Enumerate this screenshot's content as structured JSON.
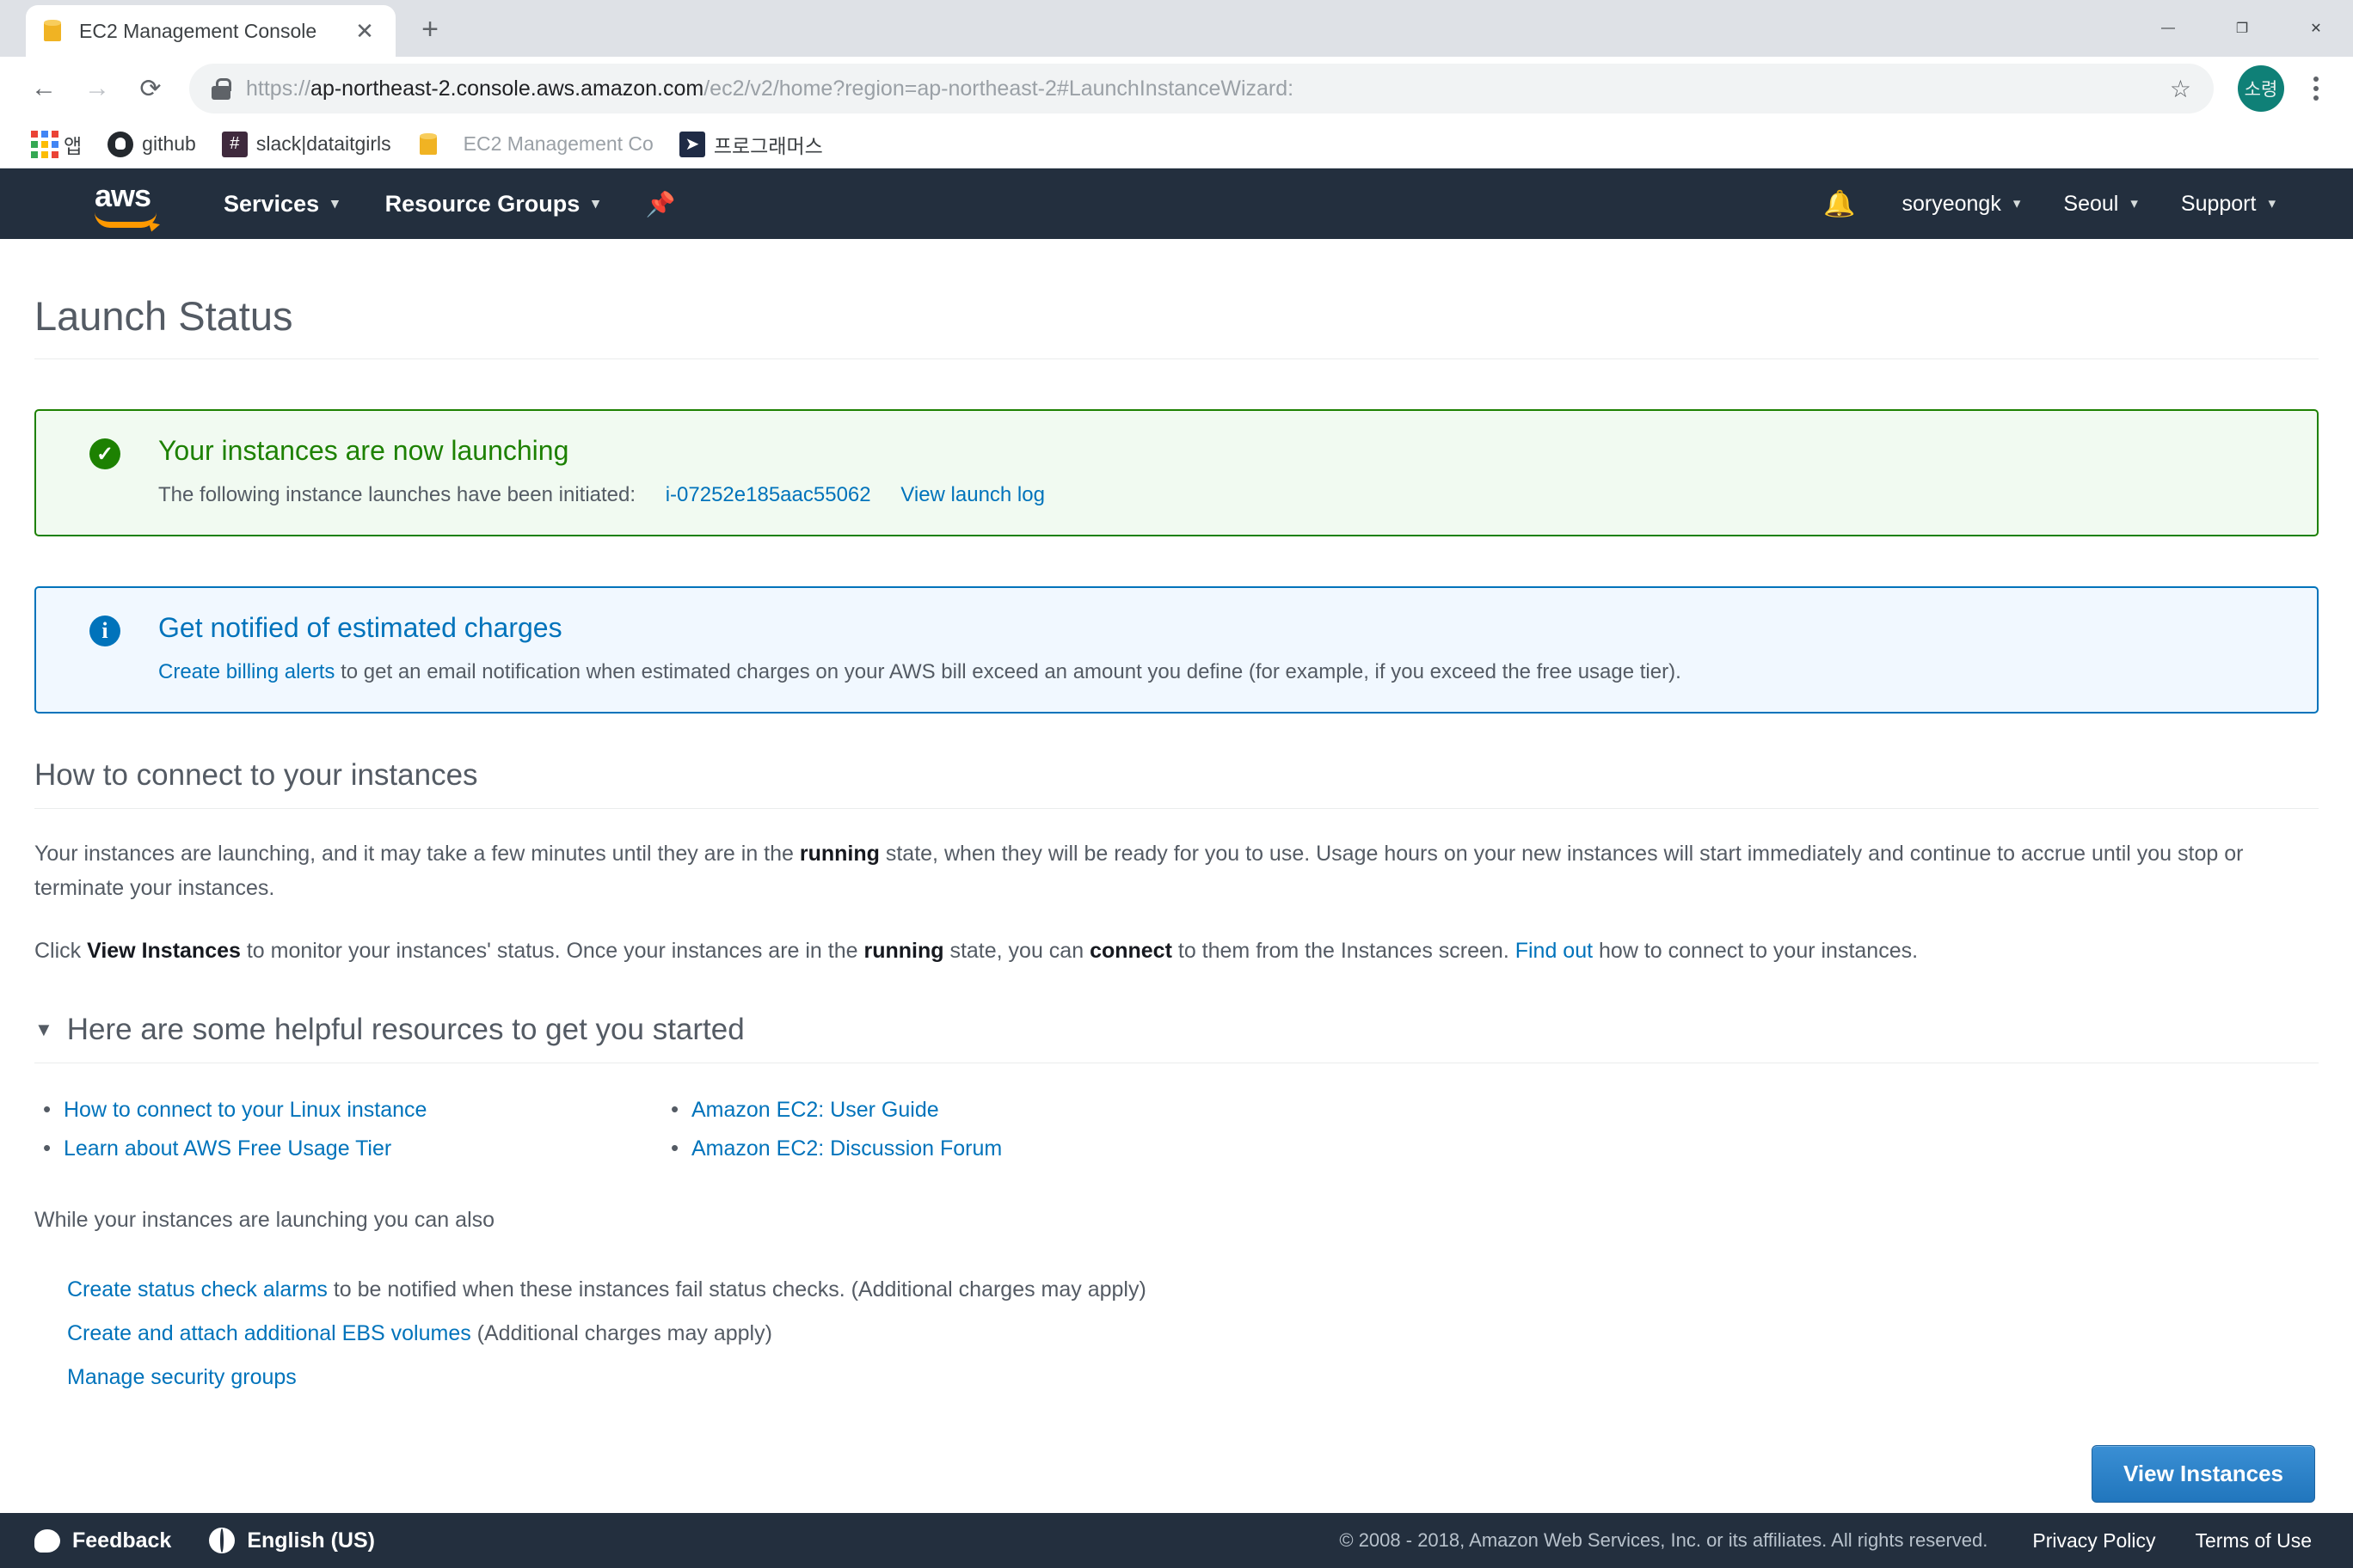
{
  "browser": {
    "tab": {
      "title": "EC2 Management Console",
      "favicon": "cube-icon",
      "close": "✕"
    },
    "new_tab_label": "+",
    "window_controls": {
      "minimize": "—",
      "maximize": "❐",
      "close": "✕"
    },
    "nav": {
      "back": "←",
      "forward": "→",
      "reload": "⟳"
    },
    "address": {
      "scheme": "https://",
      "host": "ap-northeast-2.console.aws.amazon.com",
      "path": "/ec2/v2/home?region=ap-northeast-2#LaunchInstanceWizard:",
      "star": "☆"
    },
    "profile_initials": "소령",
    "bookmarks": [
      {
        "label": "앱",
        "icon": "apps-grid-icon"
      },
      {
        "label": "github",
        "icon": "github-icon"
      },
      {
        "label": "slack|dataitgirls",
        "icon": "slack-icon"
      },
      {
        "label": "EC2 Management Co",
        "icon": "cube-icon"
      },
      {
        "label": "프로그래머스",
        "icon": "programmers-icon"
      }
    ]
  },
  "aws_nav": {
    "logo": "aws",
    "services": "Services",
    "resource_groups": "Resource Groups",
    "pin": "📌",
    "bell": "🔔",
    "account": "soryeongk",
    "region": "Seoul",
    "support": "Support",
    "caret": "▾"
  },
  "page": {
    "title": "Launch Status",
    "success_alert": {
      "heading": "Your instances are now launching",
      "sub_prefix": "The following instance launches have been initiated:",
      "instance_id": "i-07252e185aac55062",
      "view_log_link": "View launch log"
    },
    "info_alert": {
      "heading": "Get notified of estimated charges",
      "link": "Create billing alerts",
      "sub": "to get an email notification when estimated charges on your AWS bill exceed an amount you define (for example, if you exceed the free usage tier)."
    },
    "connect_section": {
      "heading": "How to connect to your instances",
      "p1_a": "Your instances are launching, and it may take a few minutes until they are in the ",
      "p1_bold1": "running",
      "p1_b": " state, when they will be ready for you to use. Usage hours on your new instances will start immediately and continue to accrue until you stop or terminate your instances.",
      "p2_a": "Click ",
      "p2_bold1": "View Instances",
      "p2_b": " to monitor your instances' status. Once your instances are in the ",
      "p2_bold2": "running",
      "p2_c": " state, you can ",
      "p2_bold3": "connect",
      "p2_d": " to them from the Instances screen. ",
      "p2_link": "Find out",
      "p2_e": " how to connect to your instances."
    },
    "resources_section": {
      "heading": "Here are some helpful resources to get you started",
      "triangle": "▼",
      "left_links": [
        "How to connect to your Linux instance",
        "Learn about AWS Free Usage Tier"
      ],
      "right_links": [
        "Amazon EC2: User Guide",
        "Amazon EC2: Discussion Forum"
      ]
    },
    "also_section": {
      "heading": "While your instances are launching you can also",
      "items": [
        {
          "link": "Create status check alarms",
          "rest": " to be notified when these instances fail status checks. (Additional charges may apply)"
        },
        {
          "link": "Create and attach additional EBS volumes",
          "rest": " (Additional charges may apply)"
        },
        {
          "link": "Manage security groups",
          "rest": ""
        }
      ]
    },
    "primary_button": "View Instances"
  },
  "footer": {
    "feedback": "Feedback",
    "language": "English (US)",
    "copyright": "© 2008 - 2018, Amazon Web Services, Inc. or its affiliates. All rights reserved.",
    "privacy": "Privacy Policy",
    "terms": "Terms of Use"
  },
  "colors": {
    "aws_dark": "#232f3e",
    "aws_orange": "#ff9900",
    "link_blue": "#0073bb",
    "success_green": "#1d8102",
    "button_blue": "#2176bd"
  }
}
